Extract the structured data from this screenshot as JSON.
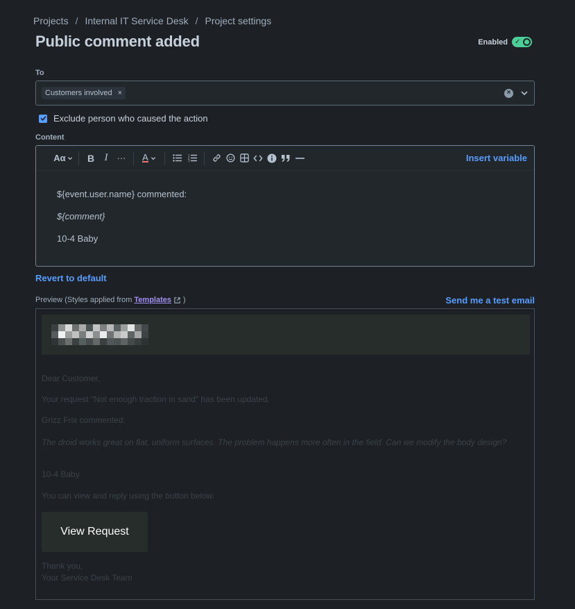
{
  "breadcrumb": {
    "items": [
      "Projects",
      "Internal IT Service Desk",
      "Project settings"
    ],
    "separator": "/"
  },
  "page": {
    "title": "Public comment added"
  },
  "toggle": {
    "label": "Enabled",
    "state": "on",
    "color": "#4bce97"
  },
  "to_field": {
    "label": "To",
    "tags": [
      {
        "label": "Customers involved",
        "remove": "×"
      }
    ]
  },
  "exclude": {
    "label": "Exclude person who caused the action",
    "checked": true
  },
  "content": {
    "label": "Content",
    "toolbar": {
      "text_style": "Aα",
      "bold": "B",
      "italic": "I",
      "more": "···",
      "text_color": "A",
      "insert_variable": "Insert variable",
      "icons": [
        "text-style-icon",
        "bold-icon",
        "italic-icon",
        "more-formatting-icon",
        "text-color-icon",
        "bullet-list-icon",
        "numbered-list-icon",
        "link-icon",
        "emoji-icon",
        "table-icon",
        "code-icon",
        "info-panel-icon",
        "quote-icon",
        "divider-icon"
      ]
    },
    "lines": [
      {
        "text": "${event.user.name} commented:",
        "italic": false
      },
      {
        "text": "${comment}",
        "italic": true
      },
      {
        "text": "10-4 Baby",
        "italic": false
      }
    ]
  },
  "revert_label": "Revert to default",
  "preview": {
    "label_prefix": "Preview (Styles applied from ",
    "templates_link": "Templates",
    "send_test": "Send me a test email",
    "greeting": "Dear Customer,",
    "updated": "Your request \"Not enough traction in sand\" has been updated.",
    "commenter": "Grizz Frix commented:",
    "comment": "The droid works great on flat, uniform surfaces. The problem happens more often in the field. Can we modify the body design?",
    "reply": "10-4 Baby",
    "view_reply": "You can view and reply using the button below.",
    "button": "View Request",
    "thanks": "Thank you,",
    "signoff": "Your Service Desk Team"
  },
  "colors": {
    "background": "#1d2125",
    "link": "#579dff",
    "templates_link": "#9f8fef",
    "preview_header": "#262d2b"
  }
}
